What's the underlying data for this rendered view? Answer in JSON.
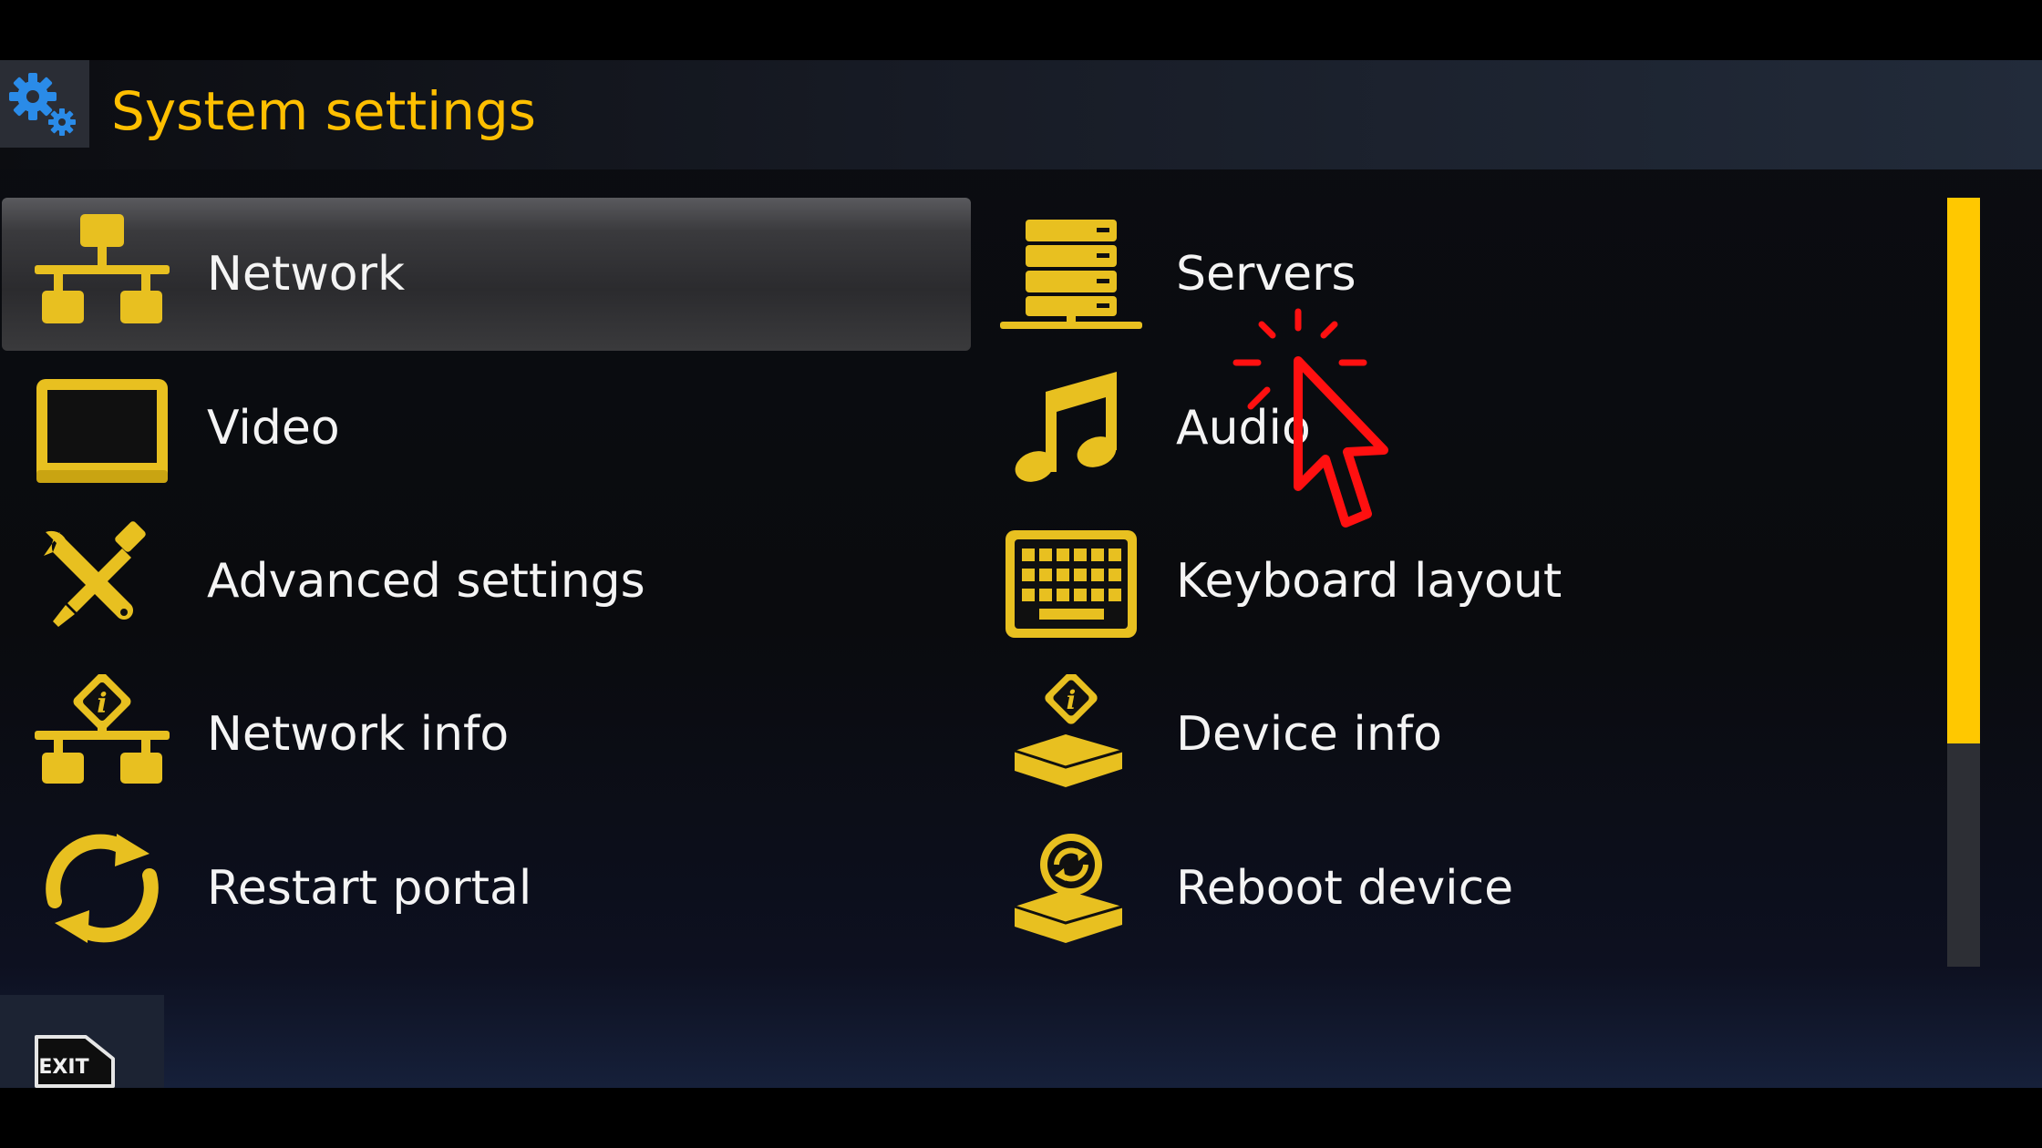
{
  "header": {
    "title": "System settings",
    "icon": "gears-icon"
  },
  "menu": {
    "items": [
      {
        "label": "Network",
        "icon": "network-icon",
        "selected": true
      },
      {
        "label": "Servers",
        "icon": "servers-icon",
        "selected": false
      },
      {
        "label": "Video",
        "icon": "monitor-icon",
        "selected": false
      },
      {
        "label": "Audio",
        "icon": "music-note-icon",
        "selected": false
      },
      {
        "label": "Advanced settings",
        "icon": "wrench-screwdriver-icon",
        "selected": false
      },
      {
        "label": "Keyboard layout",
        "icon": "keyboard-icon",
        "selected": false
      },
      {
        "label": "Network info",
        "icon": "network-info-icon",
        "selected": false
      },
      {
        "label": "Device info",
        "icon": "device-info-icon",
        "selected": false
      },
      {
        "label": "Restart portal",
        "icon": "restart-icon",
        "selected": false
      },
      {
        "label": "Reboot device",
        "icon": "reboot-device-icon",
        "selected": false
      }
    ]
  },
  "footer": {
    "exit_label": "EXIT"
  },
  "scrollbar": {
    "visible_fraction": 0.71,
    "position": 0
  },
  "colors": {
    "accent": "#ffc800",
    "title": "#ffbf00",
    "icon": "#e8c020",
    "cursor": "#ff1010"
  }
}
